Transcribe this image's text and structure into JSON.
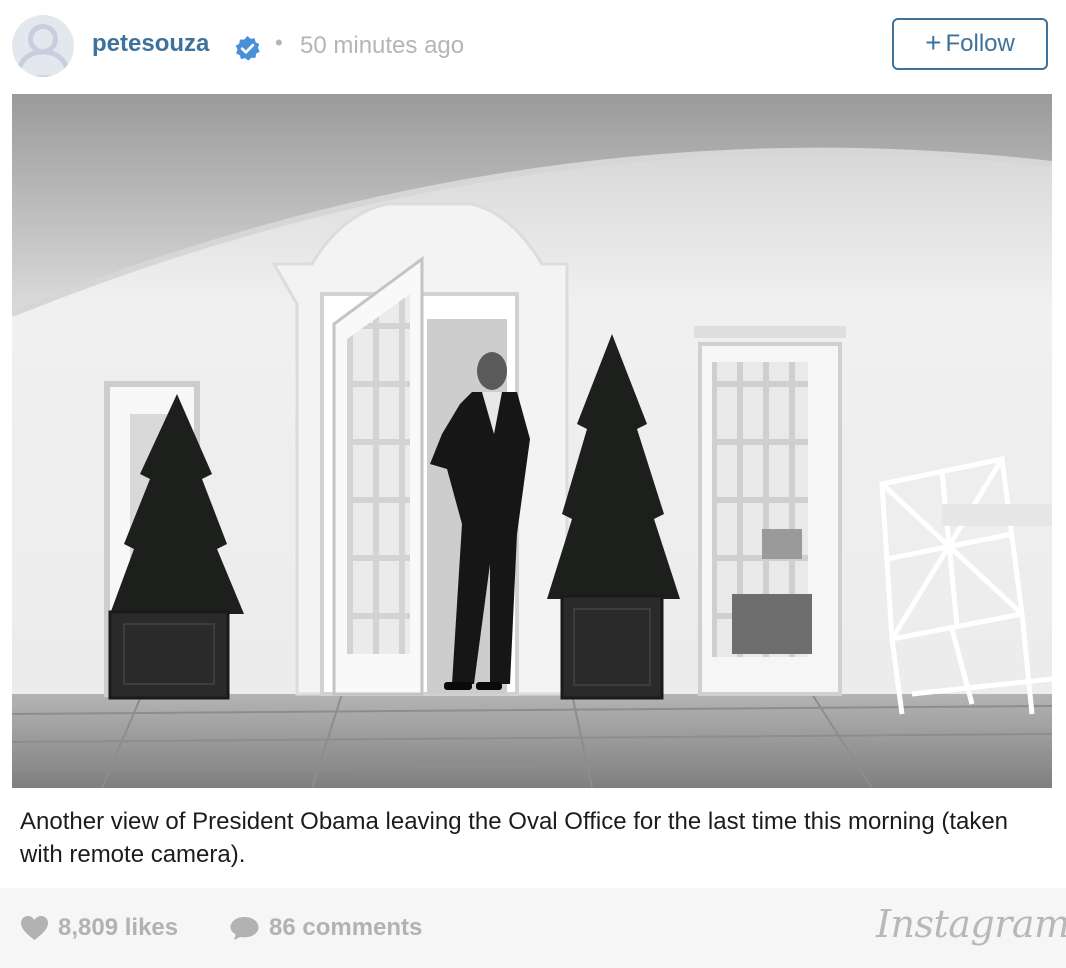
{
  "post": {
    "username": "petesouza",
    "verified_icon": "verified-badge-icon",
    "separator": "•",
    "time_ago": "50 minutes ago",
    "follow": {
      "plus": "+",
      "label": "Follow"
    }
  },
  "photo": {
    "style": "black-and-white",
    "subject": "President Obama leaving the Oval Office"
  },
  "caption": "Another view of President Obama leaving the Oval Office for the last time this morning (taken with remote camera).",
  "stats": {
    "likes": "8,809 likes",
    "comments": "86 comments",
    "like_icon": "heart-icon",
    "comment_icon": "comment-bubble-icon"
  },
  "brand": {
    "wordmark": "Instagram"
  },
  "colors": {
    "accent": "#3f729b",
    "muted": "#b5b5b5",
    "footer_bg": "#f6f6f6"
  }
}
